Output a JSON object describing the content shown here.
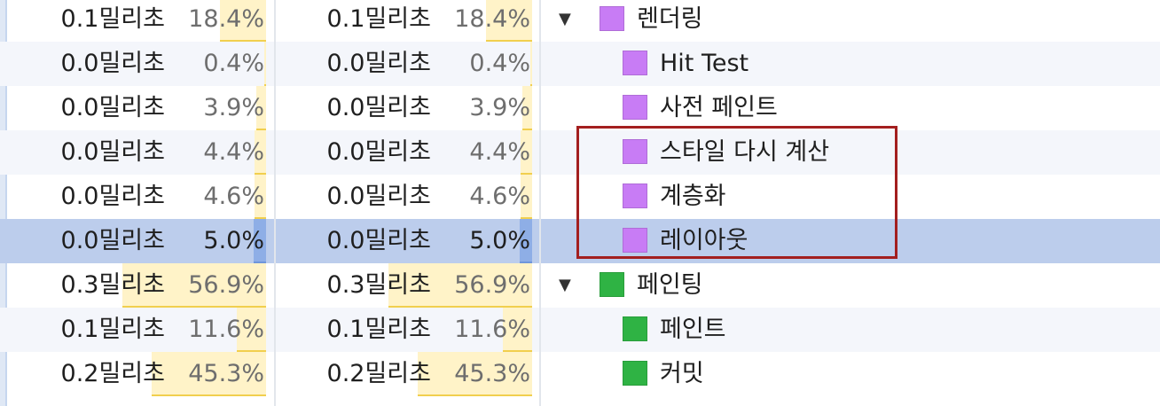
{
  "colors": {
    "rendering": "#c87cf5",
    "painting": "#2fb344",
    "bar_fill": "#fff3c8",
    "selected_row": "#bccdec",
    "highlight_box": "#a31f1f"
  },
  "rows": [
    {
      "self_time": "0.1밀리초",
      "self_percent": "18.4%",
      "total_time": "0.1밀리초",
      "total_percent": "18.4%",
      "activity": "렌더링",
      "category": "rendering",
      "level": 0,
      "expanded": true,
      "bar_fraction": 0.184
    },
    {
      "self_time": "0.0밀리초",
      "self_percent": "0.4%",
      "total_time": "0.0밀리초",
      "total_percent": "0.4%",
      "activity": "Hit Test",
      "category": "rendering",
      "level": 1,
      "bar_fraction": 0.004
    },
    {
      "self_time": "0.0밀리초",
      "self_percent": "3.9%",
      "total_time": "0.0밀리초",
      "total_percent": "3.9%",
      "activity": "사전 페인트",
      "category": "rendering",
      "level": 1,
      "bar_fraction": 0.039
    },
    {
      "self_time": "0.0밀리초",
      "self_percent": "4.4%",
      "total_time": "0.0밀리초",
      "total_percent": "4.4%",
      "activity": "스타일 다시 계산",
      "category": "rendering",
      "level": 1,
      "bar_fraction": 0.044
    },
    {
      "self_time": "0.0밀리초",
      "self_percent": "4.6%",
      "total_time": "0.0밀리초",
      "total_percent": "4.6%",
      "activity": "계층화",
      "category": "rendering",
      "level": 1,
      "bar_fraction": 0.046
    },
    {
      "self_time": "0.0밀리초",
      "self_percent": "5.0%",
      "total_time": "0.0밀리초",
      "total_percent": "5.0%",
      "activity": "레이아웃",
      "category": "rendering",
      "level": 1,
      "bar_fraction": 0.05,
      "selected": true
    },
    {
      "self_time": "0.3밀리초",
      "self_percent": "56.9%",
      "total_time": "0.3밀리초",
      "total_percent": "56.9%",
      "activity": "페인팅",
      "category": "painting",
      "level": 0,
      "expanded": true,
      "bar_fraction": 0.569
    },
    {
      "self_time": "0.1밀리초",
      "self_percent": "11.6%",
      "total_time": "0.1밀리초",
      "total_percent": "11.6%",
      "activity": "페인트",
      "category": "painting",
      "level": 1,
      "bar_fraction": 0.116
    },
    {
      "self_time": "0.2밀리초",
      "self_percent": "45.3%",
      "total_time": "0.2밀리초",
      "total_percent": "45.3%",
      "activity": "커밋",
      "category": "painting",
      "level": 1,
      "bar_fraction": 0.453
    }
  ],
  "icons": {
    "expanded_arrow": "▼"
  }
}
